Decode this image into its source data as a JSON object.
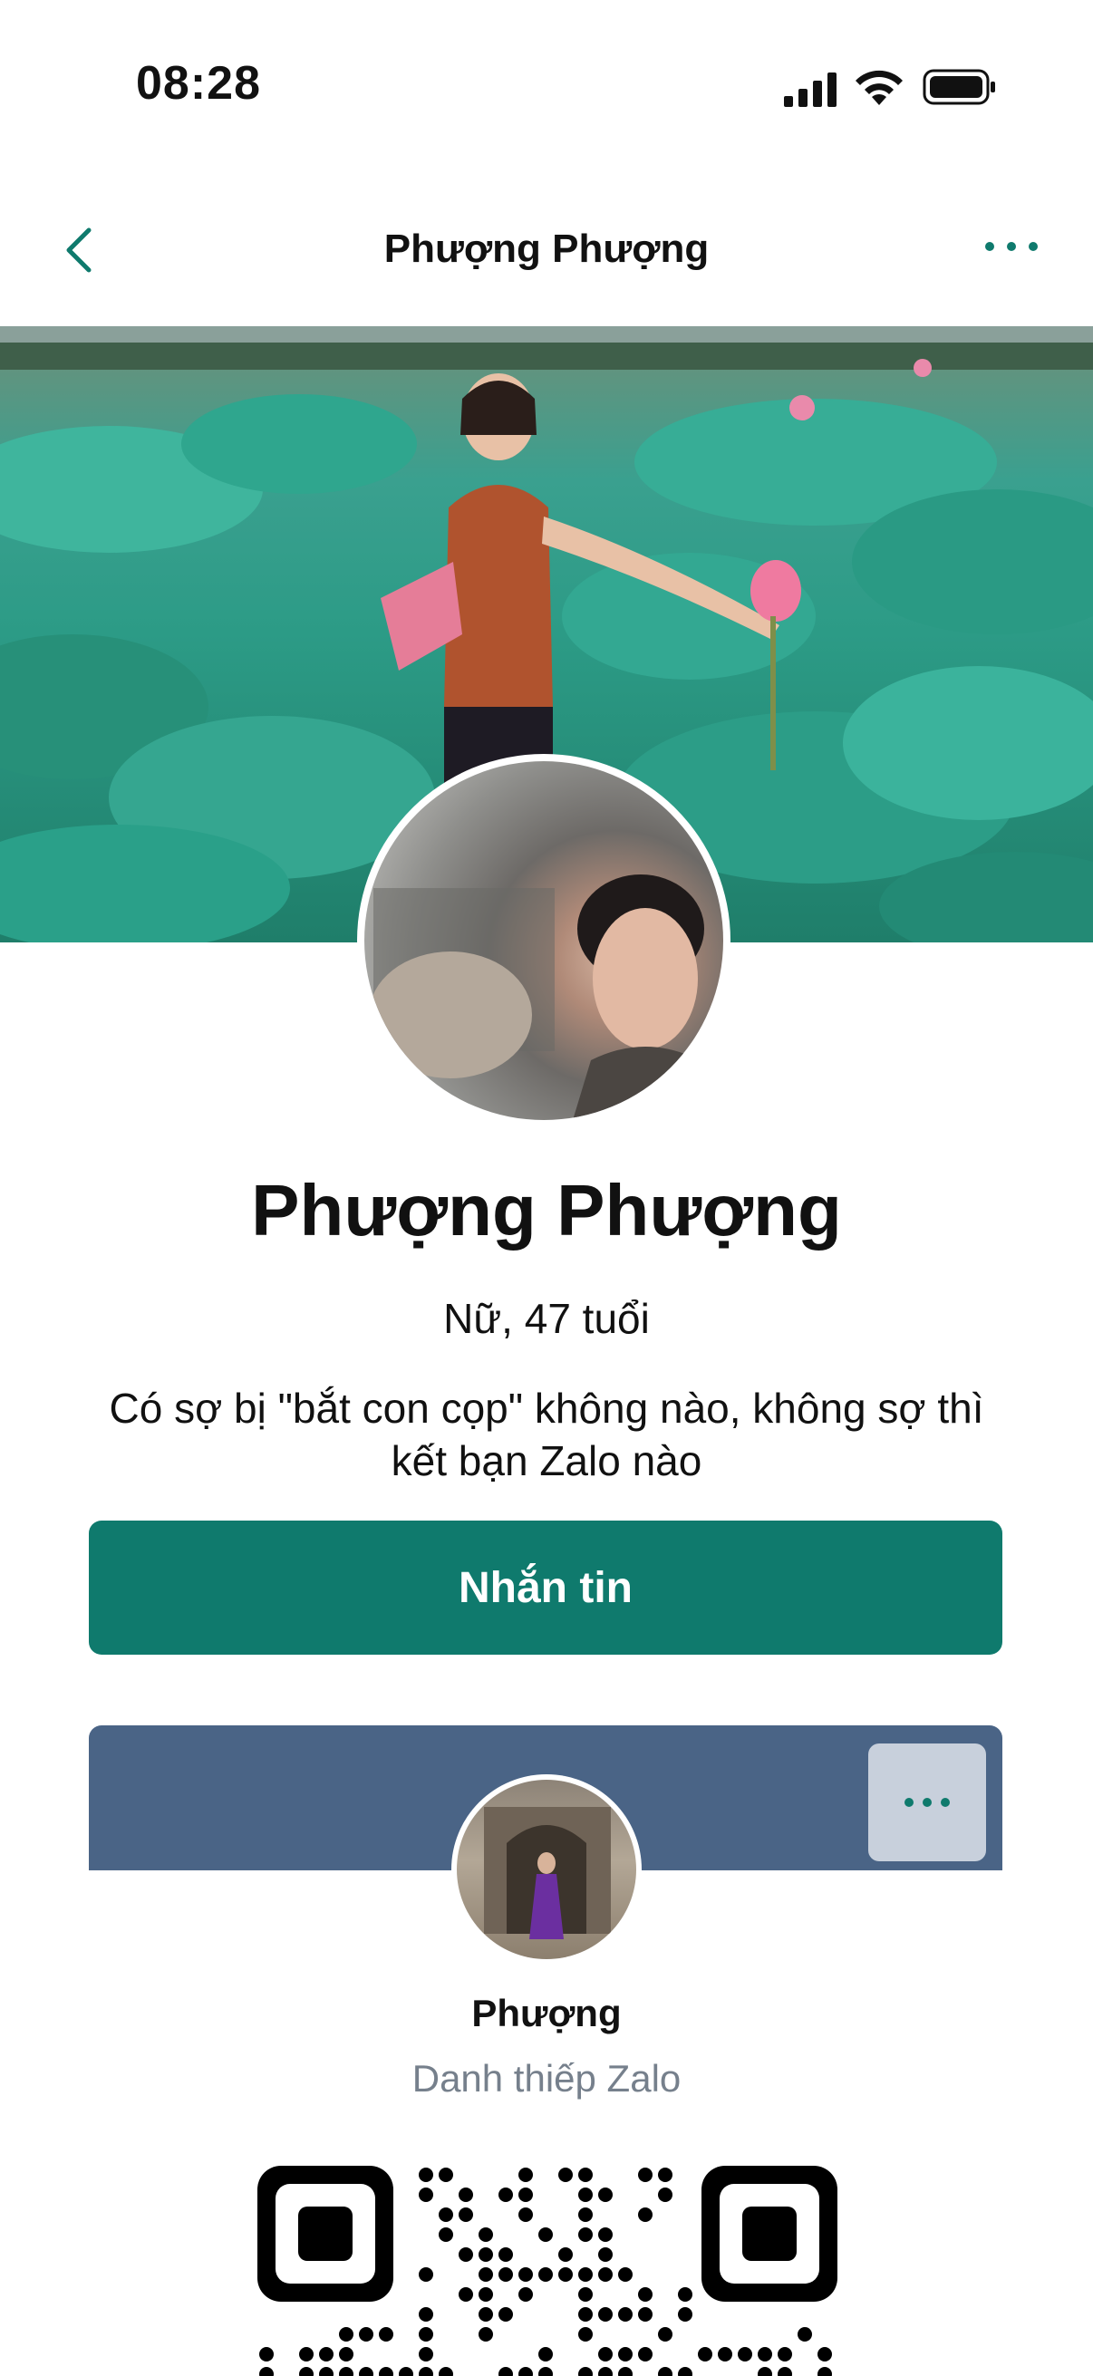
{
  "status_bar": {
    "time": "08:28"
  },
  "nav": {
    "title": "Phượng Phượng"
  },
  "profile": {
    "name": "Phượng Phượng",
    "meta": "Nữ, 47 tuổi",
    "bio": "Có sợ bị \"bắt con cọp\" không nào, không sợ thì kết bạn Zalo nào",
    "message_button": "Nhắn tin"
  },
  "card": {
    "name": "Phượng",
    "subtitle": "Danh thiếp Zalo"
  },
  "colors": {
    "accent": "#0f7a6d",
    "card_header": "#4a6486",
    "subtitle_gray": "#76808c"
  },
  "icons": [
    "signal-icon",
    "wifi-icon",
    "battery-icon",
    "back-icon",
    "more-icon",
    "qr-code"
  ]
}
